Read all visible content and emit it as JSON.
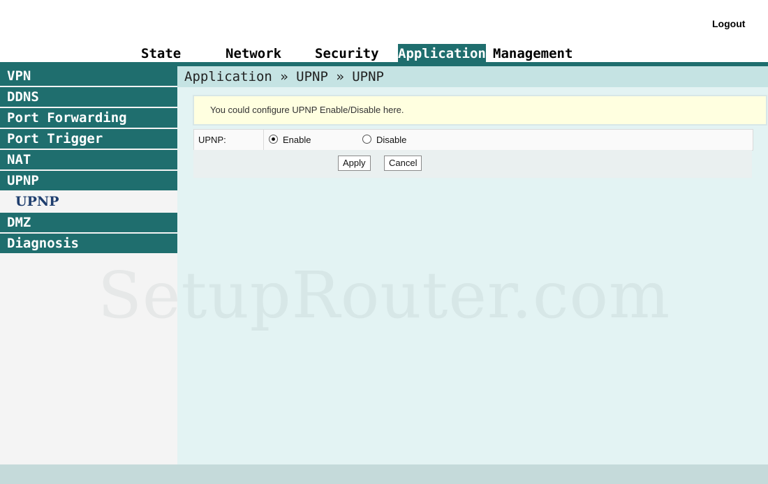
{
  "header": {
    "logout_label": "Logout"
  },
  "topnav": {
    "tabs": [
      {
        "label": "State"
      },
      {
        "label": "Network"
      },
      {
        "label": "Security"
      },
      {
        "label": "Application",
        "active": true
      },
      {
        "label": "Management"
      }
    ]
  },
  "sidebar": {
    "items": [
      {
        "label": "VPN"
      },
      {
        "label": "DDNS"
      },
      {
        "label": "Port Forwarding"
      },
      {
        "label": "Port Trigger"
      },
      {
        "label": "NAT"
      },
      {
        "label": "UPNP",
        "expanded": true
      },
      {
        "label": "UPNP",
        "sub": true,
        "selected": true
      },
      {
        "label": "DMZ"
      },
      {
        "label": "Diagnosis"
      }
    ]
  },
  "main": {
    "breadcrumb": "Application » UPNP » UPNP",
    "notice": "You could configure UPNP Enable/Disable here.",
    "upnp": {
      "label": "UPNP:",
      "enable_label": "Enable",
      "disable_label": "Disable",
      "selected": "Enable"
    },
    "apply_label": "Apply",
    "cancel_label": "Cancel"
  },
  "watermark": "SetupRouter.com",
  "colors": {
    "accent": "#1f6e6e",
    "content_bg": "#e3f3f3",
    "breadcrumb_bg": "#c5e3e3",
    "notice_bg": "#ffffe0"
  }
}
